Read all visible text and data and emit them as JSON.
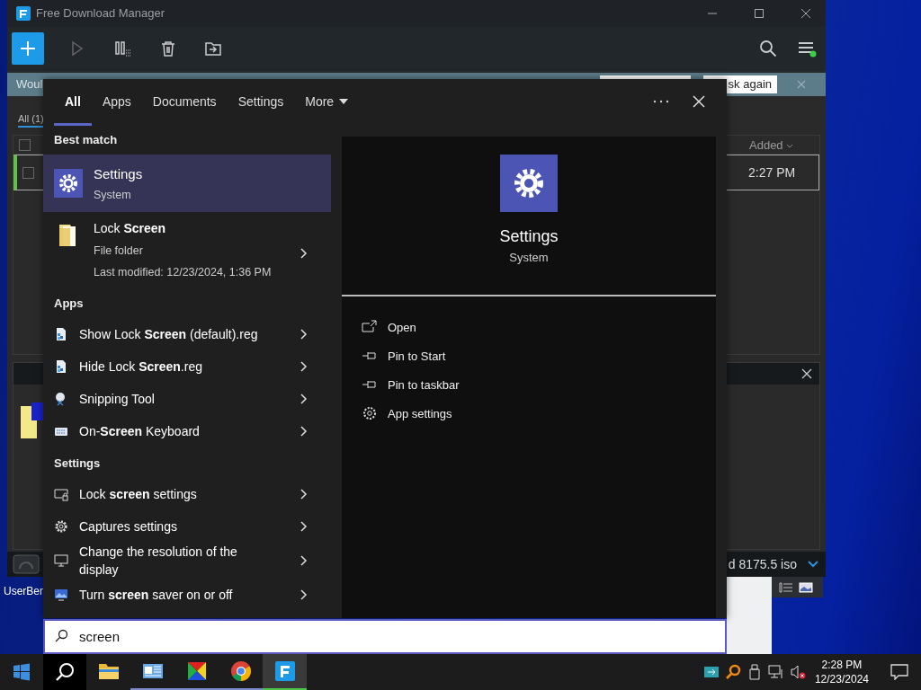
{
  "fdm_window": {
    "title": "Free Download Manager",
    "notification": {
      "text": "Woul",
      "button": "sk again"
    },
    "filter_tab": {
      "label": "All (1)",
      "selected": true
    },
    "table": {
      "column": "Added",
      "all_checked": false,
      "rows": [
        {
          "added": "2:27 PM",
          "selected": true,
          "checked": false
        }
      ]
    },
    "bottom_text": "d 8175.5 iso"
  },
  "desktop_icons": [
    {
      "label": "UserBen"
    }
  ],
  "search": {
    "tabs": [
      {
        "label": "All",
        "selected": true,
        "kind": "tab"
      },
      {
        "label": "Apps",
        "selected": false,
        "kind": "tab"
      },
      {
        "label": "Documents",
        "selected": false,
        "kind": "tab"
      },
      {
        "label": "Settings",
        "selected": false,
        "kind": "tab"
      },
      {
        "label": "More",
        "selected": false,
        "kind": "dropdown"
      }
    ],
    "results": [
      {
        "heading": "Best match",
        "items": [
          {
            "kind": "best",
            "title": "Settings",
            "subtitle": "System",
            "selected": true
          },
          {
            "kind": "folder",
            "title": "Lock **Screen**",
            "subtitle": "File folder",
            "detail": "Last modified: 12/23/2024, 1:36 PM",
            "selected": false
          }
        ]
      },
      {
        "heading": "Apps",
        "items": [
          {
            "kind": "item",
            "title": "Show Lock **Screen** (default).reg",
            "selected": false
          },
          {
            "kind": "item",
            "title": "Hide Lock **Screen**.reg",
            "selected": false
          },
          {
            "kind": "item",
            "title": "Snipping Tool",
            "selected": false
          },
          {
            "kind": "item",
            "title": "On-**Screen** Keyboard",
            "selected": false
          }
        ]
      },
      {
        "heading": "Settings",
        "items": [
          {
            "kind": "item",
            "title": "Lock **screen** settings",
            "selected": false
          },
          {
            "kind": "item",
            "title": "Captures settings",
            "selected": false
          },
          {
            "kind": "item",
            "title": "Change the resolution of the display",
            "selected": false
          },
          {
            "kind": "item",
            "title": "Turn **screen** saver on or off",
            "selected": false
          }
        ]
      }
    ],
    "preview": {
      "title": "Settings",
      "subtitle": "System",
      "actions": [
        {
          "label": "Open"
        },
        {
          "label": "Pin to Start"
        },
        {
          "label": "Pin to taskbar"
        },
        {
          "label": "App settings"
        }
      ]
    },
    "query": "screen"
  },
  "taskbar": {
    "search_button": {
      "selected": true
    },
    "apps": [
      {
        "running": false,
        "selected": false
      },
      {
        "running": true,
        "selected": false
      },
      {
        "running": true,
        "selected": false
      },
      {
        "running": true,
        "selected": false
      },
      {
        "running": true,
        "selected": true
      }
    ],
    "time": "2:28 PM",
    "date": "12/23/2024"
  }
}
